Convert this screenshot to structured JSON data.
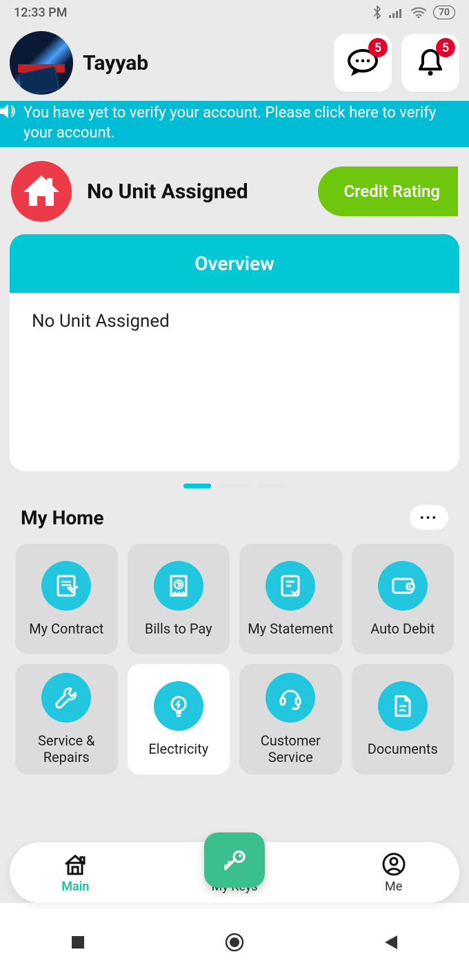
{
  "status_bar": {
    "time": "12:33 PM",
    "battery": "70"
  },
  "header": {
    "username": "Tayyab",
    "chat_badge": "5",
    "bell_badge": "5"
  },
  "verify_banner": "You have yet to verify your account. Please click here to verify your account.",
  "unit": {
    "title": "No Unit Assigned",
    "credit_btn": "Credit Rating"
  },
  "overview": {
    "header": "Overview",
    "body": "No Unit Assigned"
  },
  "section_title": "My Home",
  "tiles": [
    {
      "label": "My Contract",
      "icon": "contract-icon"
    },
    {
      "label": "Bills to Pay",
      "icon": "bills-icon"
    },
    {
      "label": "My Statement",
      "icon": "statement-icon"
    },
    {
      "label": "Auto Debit",
      "icon": "wallet-icon"
    },
    {
      "label": "Service & Repairs",
      "icon": "wrench-icon",
      "two": true
    },
    {
      "label": "Electricity",
      "icon": "bulb-icon",
      "white": true
    },
    {
      "label": "Customer Service",
      "icon": "headset-icon",
      "two": true
    },
    {
      "label": "Documents",
      "icon": "document-icon"
    }
  ],
  "tabs": {
    "main": "Main",
    "keys": "My Keys",
    "me": "Me"
  }
}
